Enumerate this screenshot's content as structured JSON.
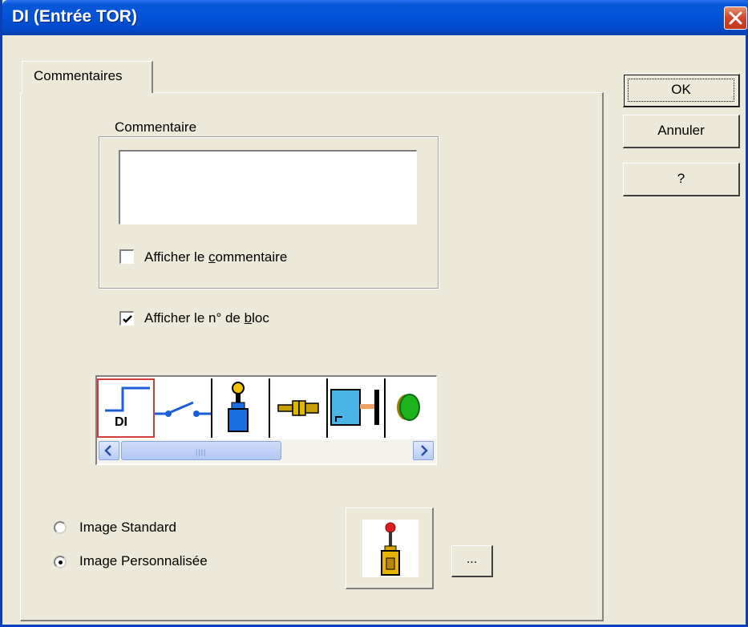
{
  "window": {
    "title": "DI (Entrée TOR)"
  },
  "tabs": [
    {
      "label": "Commentaires"
    }
  ],
  "buttons": {
    "ok": "OK",
    "cancel": "Annuler",
    "help": "?",
    "browse": "..."
  },
  "comment_group": {
    "label": "Commentaire",
    "textarea_value": "",
    "show_comment": {
      "label_pre": "Afficher le ",
      "label_key": "c",
      "label_post": "ommentaire",
      "checked": false
    }
  },
  "show_block_number": {
    "label_pre": "Afficher le n° de ",
    "label_key": "b",
    "label_post": "loc",
    "checked": true
  },
  "image_strip": {
    "items": [
      "di-signal-icon",
      "switch-contact-icon",
      "limit-switch-icon",
      "proximity-sensor-icon",
      "photoelectric-sensor-icon",
      "push-button-icon"
    ],
    "selected_index": 0,
    "di_label": "DI"
  },
  "image_mode": {
    "options": [
      {
        "label": "Image Standard",
        "selected": false
      },
      {
        "label": "Image Personnalisée",
        "selected": true
      }
    ]
  },
  "colors": {
    "title_bar": "#0453d8",
    "selection_border": "#d23c3c"
  }
}
